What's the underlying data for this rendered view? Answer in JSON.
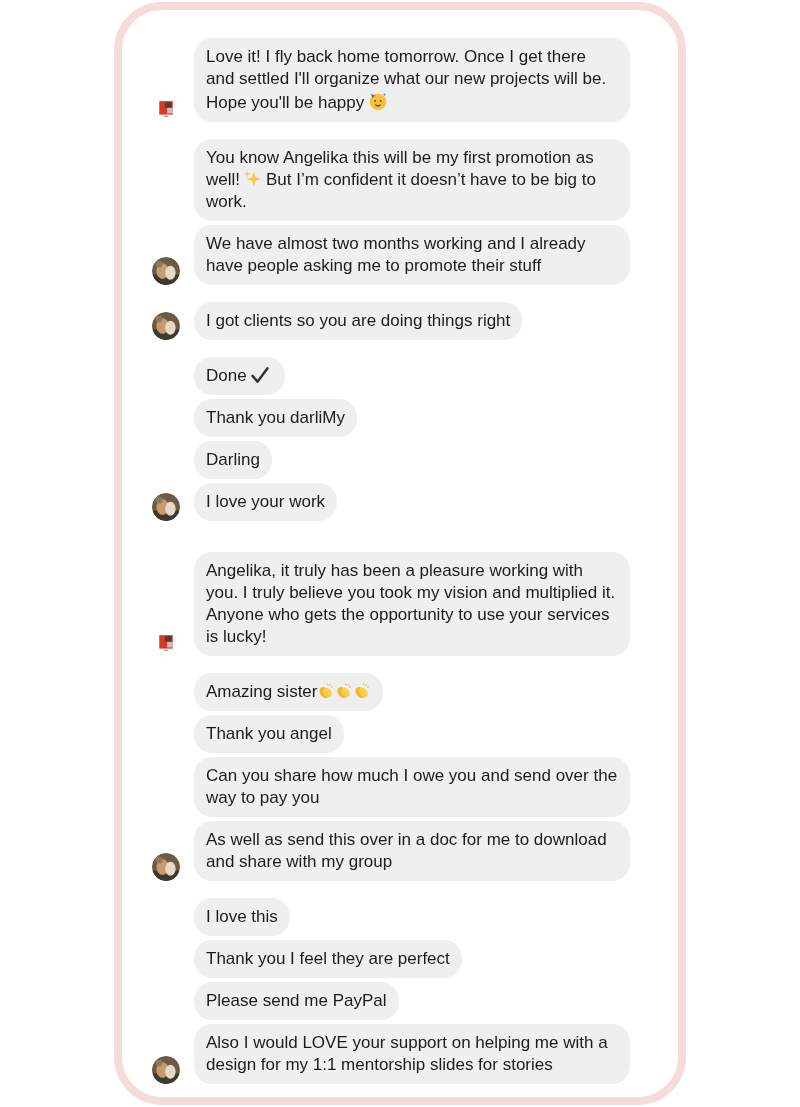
{
  "groups": [
    {
      "avatar": {
        "kind": "square"
      },
      "messages": [
        {
          "parts": [
            {
              "kind": "text",
              "text": "Love it! I fly back home tomorrow. Once I get there and settled I'll organize what our new projects will be. Hope you'll be happy"
            },
            {
              "kind": "party"
            }
          ]
        }
      ]
    },
    {
      "avatar": {
        "kind": "round"
      },
      "messages": [
        {
          "parts": [
            {
              "kind": "text",
              "text": "You know Angelika this will be my first promotion as well!"
            },
            {
              "kind": "sparkles"
            },
            {
              "kind": "text",
              "text": "But I’m confident it doesn’t have to be big to work."
            }
          ]
        },
        {
          "parts": [
            {
              "kind": "text",
              "text": "We have almost two months working and I already have people asking me to promote their stuff"
            }
          ]
        }
      ]
    },
    {
      "avatar": {
        "kind": "round"
      },
      "messages": [
        {
          "parts": [
            {
              "kind": "text",
              "text": "I got clients so you are doing things right"
            }
          ]
        }
      ]
    },
    {
      "avatar": {
        "kind": "round"
      },
      "messages": [
        {
          "parts": [
            {
              "kind": "text",
              "text": "Done"
            },
            {
              "kind": "check"
            }
          ]
        },
        {
          "parts": [
            {
              "kind": "text",
              "text": "Thank you darliMy"
            }
          ]
        },
        {
          "parts": [
            {
              "kind": "text",
              "text": "Darling"
            }
          ]
        },
        {
          "parts": [
            {
              "kind": "text",
              "text": "I love your work"
            }
          ]
        }
      ]
    },
    {
      "avatar": {
        "kind": "square"
      },
      "messages": [
        {
          "parts": [
            {
              "kind": "text",
              "text": "Angelika, it truly has been a pleasure working with you. I truly believe you took my vision and multiplied it. Anyone who gets the opportunity to use your services is lucky!"
            }
          ]
        }
      ]
    },
    {
      "avatar": {
        "kind": "round"
      },
      "messages": [
        {
          "parts": [
            {
              "kind": "text",
              "text": "Amazing sister"
            },
            {
              "kind": "clap"
            },
            {
              "kind": "clap"
            },
            {
              "kind": "clap"
            }
          ]
        },
        {
          "parts": [
            {
              "kind": "text",
              "text": "Thank you angel"
            }
          ]
        },
        {
          "parts": [
            {
              "kind": "text",
              "text": "Can you share how much I owe you and send over the way to pay you"
            }
          ]
        },
        {
          "parts": [
            {
              "kind": "text",
              "text": "As well as send this over in a doc for me to download and share with my group"
            }
          ]
        }
      ]
    },
    {
      "avatar": {
        "kind": "round"
      },
      "messages": [
        {
          "parts": [
            {
              "kind": "text",
              "text": "I love this"
            }
          ]
        },
        {
          "parts": [
            {
              "kind": "text",
              "text": "Thank you I feel they are perfect"
            }
          ]
        },
        {
          "parts": [
            {
              "kind": "text",
              "text": "Please send me PayPal"
            }
          ]
        },
        {
          "parts": [
            {
              "kind": "text",
              "text": "Also I would LOVE your support on helping me with a design for my 1:1 mentorship slides for stories"
            }
          ]
        }
      ]
    }
  ]
}
